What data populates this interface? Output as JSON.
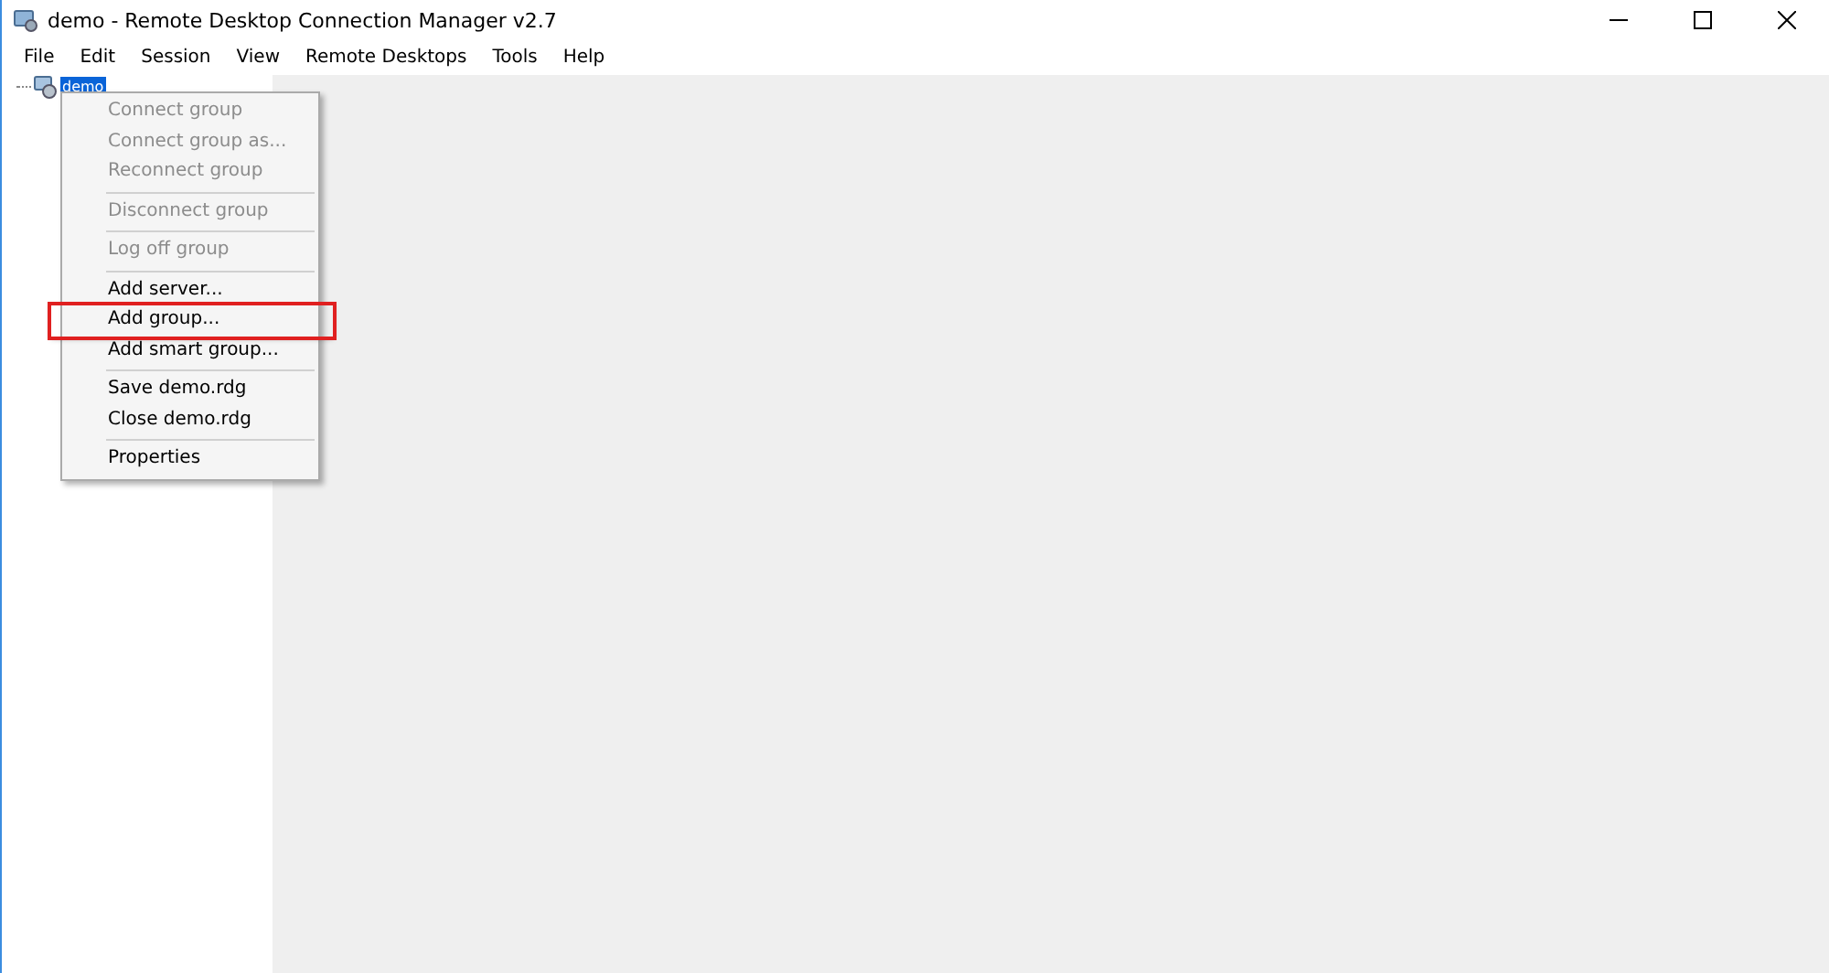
{
  "window": {
    "title": "demo - Remote Desktop Connection Manager v2.7"
  },
  "menu_bar": [
    "File",
    "Edit",
    "Session",
    "View",
    "Remote Desktops",
    "Tools",
    "Help"
  ],
  "tree": {
    "items": [
      {
        "label": "demo",
        "selected": true
      }
    ]
  },
  "context_menu": {
    "groups": [
      [
        {
          "label": "Connect group",
          "disabled": true,
          "highlighted": false
        },
        {
          "label": "Connect group as...",
          "disabled": true,
          "highlighted": false
        },
        {
          "label": "Reconnect group",
          "disabled": true,
          "highlighted": false
        }
      ],
      [
        {
          "label": "Disconnect group",
          "disabled": true,
          "highlighted": false
        }
      ],
      [
        {
          "label": "Log off group",
          "disabled": true,
          "highlighted": false
        }
      ],
      [
        {
          "label": "Add server...",
          "disabled": false,
          "highlighted": false
        },
        {
          "label": "Add group...",
          "disabled": false,
          "highlighted": true
        },
        {
          "label": "Add smart group...",
          "disabled": false,
          "highlighted": false
        }
      ],
      [
        {
          "label": "Save demo.rdg",
          "disabled": false,
          "highlighted": false
        },
        {
          "label": "Close demo.rdg",
          "disabled": false,
          "highlighted": false
        }
      ],
      [
        {
          "label": "Properties",
          "disabled": false,
          "highlighted": false
        }
      ]
    ]
  }
}
